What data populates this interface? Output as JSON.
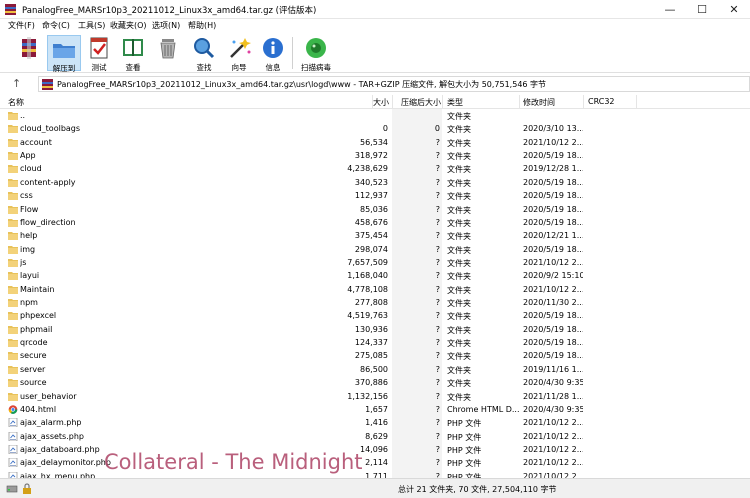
{
  "window": {
    "title": "PanalogFree_MARSr10p3_20211012_Linux3x_amd64.tar.gz (评估版本)",
    "minimize": "—",
    "maximize": "☐",
    "close": "✕"
  },
  "menu": [
    "文件(F)",
    "命令(C)",
    "工具(S)",
    "收藏夹(O)",
    "选项(N)",
    "帮助(H)"
  ],
  "toolbar": [
    {
      "label": "添加",
      "icon": "add-archive-icon"
    },
    {
      "label": "解压到",
      "icon": "extract-to-icon"
    },
    {
      "label": "测试",
      "icon": "test-icon"
    },
    {
      "label": "查看",
      "icon": "view-icon"
    },
    {
      "label": "删除",
      "icon": "delete-icon"
    },
    {
      "label": "查找",
      "icon": "find-icon"
    },
    {
      "label": "向导",
      "icon": "wizard-icon"
    },
    {
      "label": "信息",
      "icon": "info-icon"
    },
    {
      "label": "扫描病毒",
      "icon": "virus-scan-icon"
    }
  ],
  "address": {
    "path": "PanalogFree_MARSr10p3_20211012_Linux3x_amd64.tar.gz\\usr\\logd\\www - TAR+GZIP 压缩文件, 解包大小为 50,751,546 字节"
  },
  "columns": {
    "name": "名称",
    "size": "大小",
    "packed": "压缩后大小",
    "type": "类型",
    "modified": "修改时间",
    "crc": "CRC32"
  },
  "rows": [
    {
      "name": "..",
      "size": "",
      "packed": "",
      "type": "文件夹",
      "date": "",
      "kind": "folder"
    },
    {
      "name": "cloud_toolbags",
      "size": "0",
      "packed": "0",
      "type": "文件夹",
      "date": "2020/3/10 13...",
      "kind": "folder"
    },
    {
      "name": "account",
      "size": "56,534",
      "packed": "?",
      "type": "文件夹",
      "date": "2021/10/12 2...",
      "kind": "folder"
    },
    {
      "name": "App",
      "size": "318,972",
      "packed": "?",
      "type": "文件夹",
      "date": "2020/5/19 18...",
      "kind": "folder"
    },
    {
      "name": "cloud",
      "size": "4,238,629",
      "packed": "?",
      "type": "文件夹",
      "date": "2019/12/28 1...",
      "kind": "folder"
    },
    {
      "name": "content-apply",
      "size": "340,523",
      "packed": "?",
      "type": "文件夹",
      "date": "2020/5/19 18...",
      "kind": "folder"
    },
    {
      "name": "css",
      "size": "112,937",
      "packed": "?",
      "type": "文件夹",
      "date": "2020/5/19 18...",
      "kind": "folder"
    },
    {
      "name": "Flow",
      "size": "85,036",
      "packed": "?",
      "type": "文件夹",
      "date": "2020/5/19 18...",
      "kind": "folder"
    },
    {
      "name": "flow_direction",
      "size": "458,676",
      "packed": "?",
      "type": "文件夹",
      "date": "2020/5/19 18...",
      "kind": "folder"
    },
    {
      "name": "help",
      "size": "375,454",
      "packed": "?",
      "type": "文件夹",
      "date": "2020/12/21 1...",
      "kind": "folder"
    },
    {
      "name": "img",
      "size": "298,074",
      "packed": "?",
      "type": "文件夹",
      "date": "2020/5/19 18...",
      "kind": "folder"
    },
    {
      "name": "js",
      "size": "7,657,509",
      "packed": "?",
      "type": "文件夹",
      "date": "2021/10/12 2...",
      "kind": "folder"
    },
    {
      "name": "layui",
      "size": "1,168,040",
      "packed": "?",
      "type": "文件夹",
      "date": "2020/9/2 15:10",
      "kind": "folder"
    },
    {
      "name": "Maintain",
      "size": "4,778,108",
      "packed": "?",
      "type": "文件夹",
      "date": "2021/10/12 2...",
      "kind": "folder"
    },
    {
      "name": "npm",
      "size": "277,808",
      "packed": "?",
      "type": "文件夹",
      "date": "2020/11/30 2...",
      "kind": "folder"
    },
    {
      "name": "phpexcel",
      "size": "4,519,763",
      "packed": "?",
      "type": "文件夹",
      "date": "2020/5/19 18...",
      "kind": "folder"
    },
    {
      "name": "phpmail",
      "size": "130,936",
      "packed": "?",
      "type": "文件夹",
      "date": "2020/5/19 18...",
      "kind": "folder"
    },
    {
      "name": "qrcode",
      "size": "124,337",
      "packed": "?",
      "type": "文件夹",
      "date": "2020/5/19 18...",
      "kind": "folder"
    },
    {
      "name": "secure",
      "size": "275,085",
      "packed": "?",
      "type": "文件夹",
      "date": "2020/5/19 18...",
      "kind": "folder"
    },
    {
      "name": "server",
      "size": "86,500",
      "packed": "?",
      "type": "文件夹",
      "date": "2019/11/16 1...",
      "kind": "folder"
    },
    {
      "name": "source",
      "size": "370,886",
      "packed": "?",
      "type": "文件夹",
      "date": "2020/4/30 9:35",
      "kind": "folder"
    },
    {
      "name": "user_behavior",
      "size": "1,132,156",
      "packed": "?",
      "type": "文件夹",
      "date": "2021/11/28 1...",
      "kind": "folder"
    },
    {
      "name": "404.html",
      "size": "1,657",
      "packed": "?",
      "type": "Chrome HTML D...",
      "date": "2020/4/30 9:35",
      "kind": "html"
    },
    {
      "name": "ajax_alarm.php",
      "size": "1,416",
      "packed": "?",
      "type": "PHP 文件",
      "date": "2021/10/12 2...",
      "kind": "php"
    },
    {
      "name": "ajax_assets.php",
      "size": "8,629",
      "packed": "?",
      "type": "PHP 文件",
      "date": "2021/10/12 2...",
      "kind": "php"
    },
    {
      "name": "ajax_databoard.php",
      "size": "14,096",
      "packed": "?",
      "type": "PHP 文件",
      "date": "2021/10/12 2...",
      "kind": "php"
    },
    {
      "name": "ajax_delaymonitor.php",
      "size": "2,114",
      "packed": "?",
      "type": "PHP 文件",
      "date": "2021/10/12 2...",
      "kind": "php"
    },
    {
      "name": "ajax_hx_menu.php",
      "size": "1,711",
      "packed": "?",
      "type": "PHP 文件",
      "date": "2021/10/12 2...",
      "kind": "php"
    }
  ],
  "watermark": "Collateral - The Midnight",
  "status": {
    "summary": "总计 21 文件夹, 70 文件, 27,504,110 字节"
  },
  "colors": {
    "folder": "#e8c25a",
    "selected_bg": "#cce4f7",
    "watermark": "#ad4466"
  }
}
